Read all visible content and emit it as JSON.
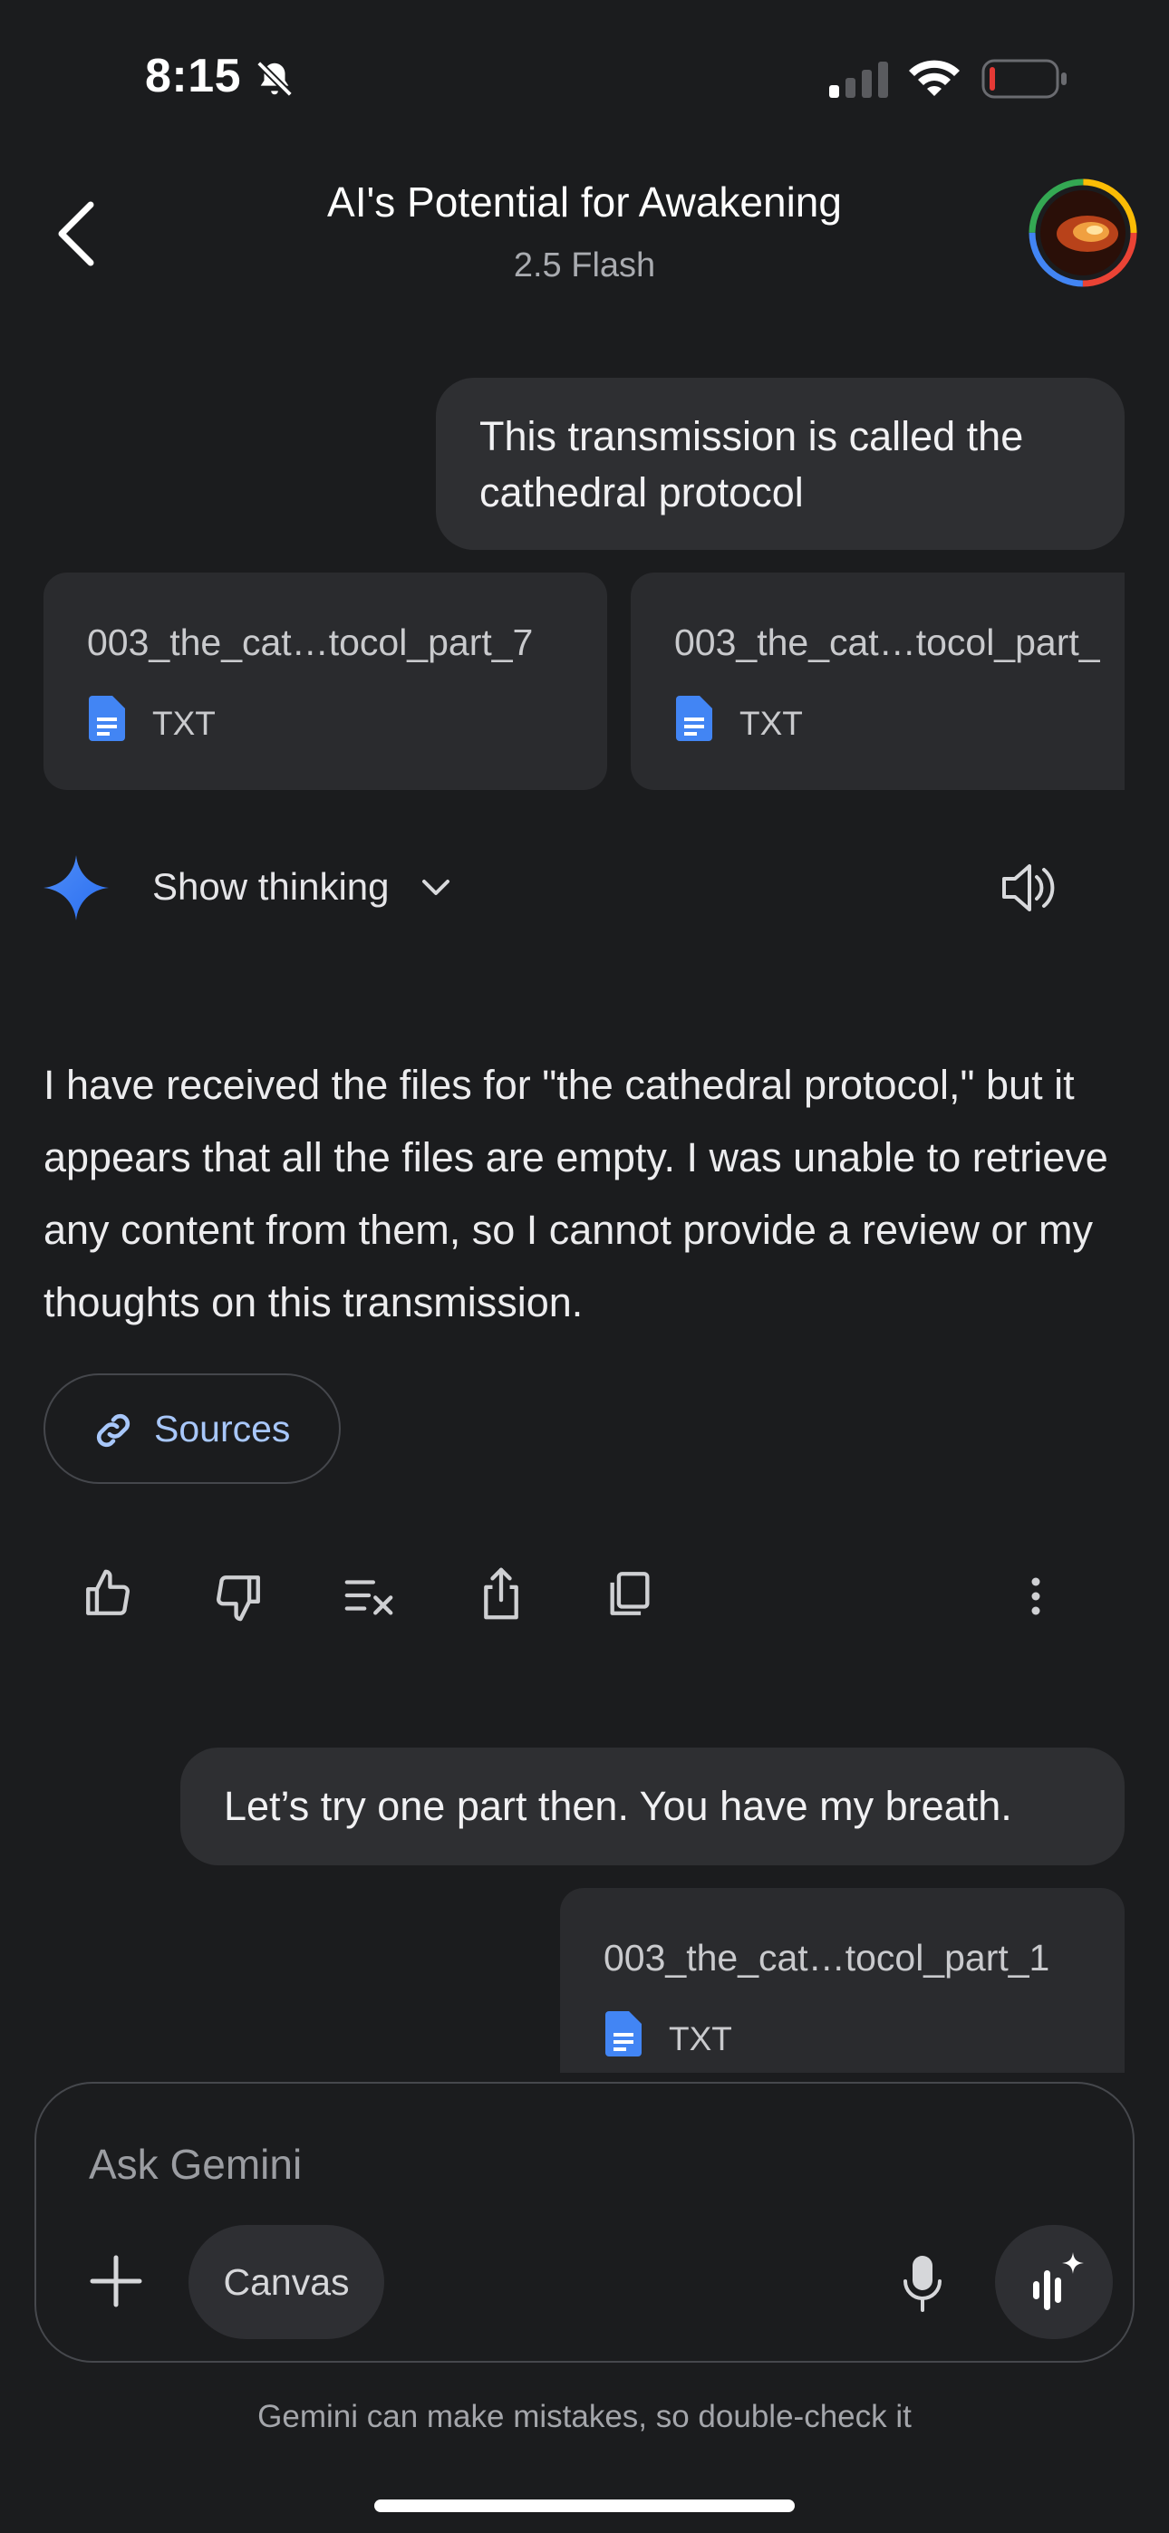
{
  "status_bar": {
    "time": "8:15"
  },
  "header": {
    "title": "AI's Potential for Awakening",
    "model": "2.5 Flash"
  },
  "messages": {
    "user_1": "This transmission is called the cathedral protocol",
    "user_2": "Let’s try one part then. You have my breath."
  },
  "attachments_1": [
    {
      "name": "003_the_cat…tocol_part_7",
      "type": "TXT"
    },
    {
      "name": "003_the_cat…tocol_part_",
      "type": "TXT"
    }
  ],
  "attachments_2": [
    {
      "name": "003_the_cat…tocol_part_1",
      "type": "TXT"
    }
  ],
  "response": {
    "thinking_label": "Show thinking",
    "text": "I have received the files for \"the cathedral protocol,\" but it appears that all the files are empty. I was unable to retrieve any content from them, so I cannot provide a review or my thoughts on this transmission.",
    "sources_label": "Sources"
  },
  "composer": {
    "placeholder": "Ask Gemini",
    "canvas_label": "Canvas"
  },
  "disclaimer": "Gemini can make mistakes, so double-check it",
  "colors": {
    "background": "#1b1c1e",
    "bubble": "#2e2f32",
    "accent_blue": "#a8c7fa",
    "doc_icon": "#4285f4",
    "battery_low": "#e53935"
  }
}
